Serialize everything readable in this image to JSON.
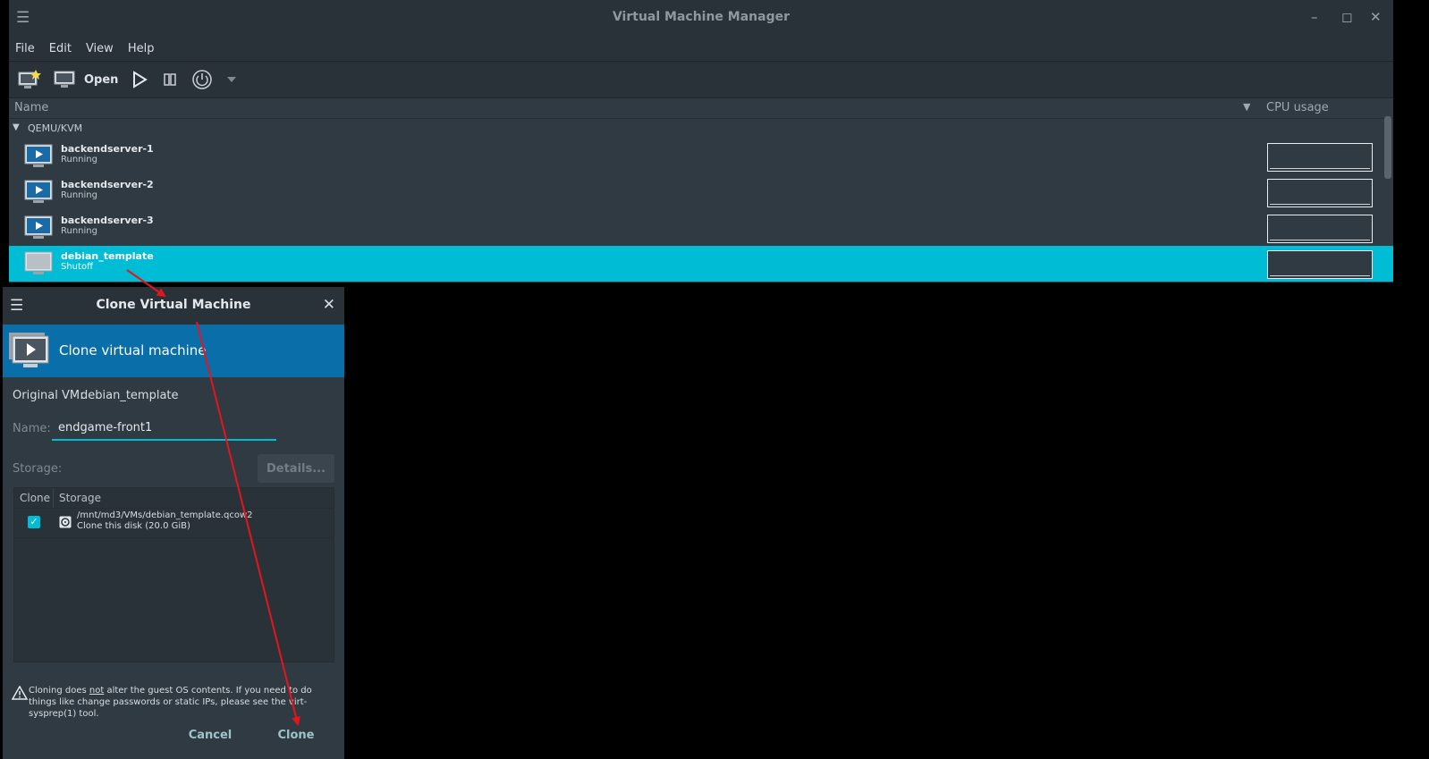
{
  "main": {
    "title": "Virtual Machine Manager",
    "menu": [
      "File",
      "Edit",
      "View",
      "Help"
    ],
    "toolbar": {
      "open_label": "Open"
    },
    "list_header": {
      "name": "Name",
      "cpu": "CPU usage"
    },
    "group": "QEMU/KVM",
    "vms": [
      {
        "name": "backendserver-1",
        "status": "Running"
      },
      {
        "name": "backendserver-2",
        "status": "Running"
      },
      {
        "name": "backendserver-3",
        "status": "Running"
      },
      {
        "name": "debian_template",
        "status": "Shutoff"
      }
    ]
  },
  "dialog": {
    "title": "Clone Virtual Machine",
    "banner": "Clone virtual machine",
    "original_label": "Original VM:",
    "original_value": "debian_template",
    "name_label": "Name:",
    "name_value": "endgame-front1",
    "storage_label": "Storage:",
    "details_label": "Details...",
    "table": {
      "col_clone": "Clone",
      "col_storage": "Storage",
      "rows": [
        {
          "checked": true,
          "path": "/mnt/md3/VMs/debian_template.qcow2",
          "note": "Clone this disk (20.0 GiB)"
        }
      ]
    },
    "warning_pre": "Cloning does ",
    "warning_em": "not",
    "warning_post": " alter the guest OS contents. If you need to do things like change passwords or static IPs, please see the virt-sysprep(1) tool.",
    "cancel_label": "Cancel",
    "clone_label": "Clone"
  },
  "colors": {
    "accent": "#00bcd4",
    "banner": "#0a6ea9",
    "annotation": "#e8141b"
  }
}
